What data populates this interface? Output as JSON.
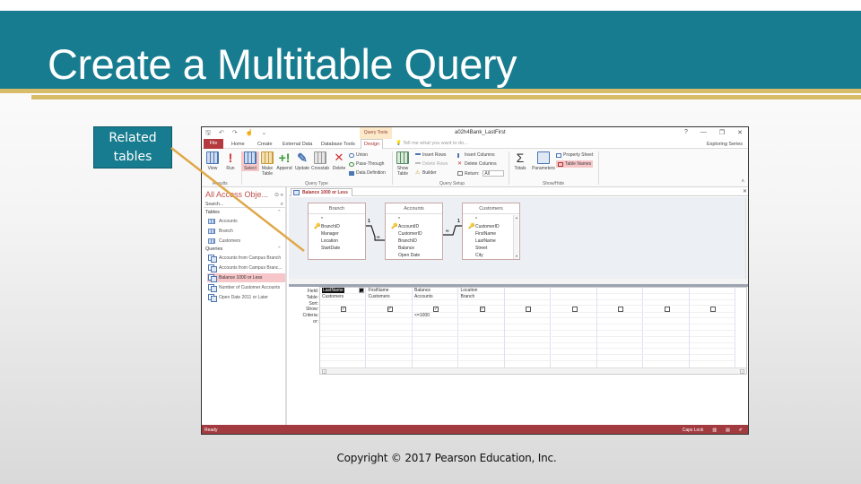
{
  "slide": {
    "title": "Create a Multitable Query",
    "callout": "Related tables",
    "copyright": "Copyright © 2017 Pearson Education, Inc.",
    "colors": {
      "header": "#177c8f",
      "accent_gold": "#d9bc6a",
      "access_red": "#a23b40"
    }
  },
  "access": {
    "context_label": "Query Tools",
    "doc_title": "a02h4Bank_LastFirst",
    "window_controls": [
      "?",
      "—",
      "❐",
      "✕"
    ],
    "user": "Exploring Series",
    "tabs": [
      "File",
      "Home",
      "Create",
      "External Data",
      "Database Tools",
      "Design"
    ],
    "tell_me": "Tell me what you want to do...",
    "ribbon": {
      "results": {
        "label": "Results",
        "buttons": [
          "View",
          "Run"
        ]
      },
      "query_type": {
        "label": "Query Type",
        "buttons": [
          "Select",
          "Make Table",
          "Append",
          "Update",
          "Crosstab",
          "Delete"
        ],
        "small": [
          "Union",
          "Pass-Through",
          "Data Definition"
        ]
      },
      "query_setup": {
        "label": "Query Setup",
        "show_table": "Show Table",
        "rows": [
          "Insert Rows",
          "Delete Rows",
          "Builder"
        ],
        "cols": [
          "Insert Columns",
          "Delete Columns",
          "Return:"
        ],
        "return_value": "All"
      },
      "show_hide": {
        "label": "Show/Hide",
        "buttons": [
          "Totals",
          "Parameters"
        ],
        "small": [
          "Property Sheet",
          "Table Names"
        ]
      }
    },
    "nav": {
      "title": "All Access Obje...",
      "search_placeholder": "Search...",
      "tables_header": "Tables",
      "tables": [
        "Accounts",
        "Branch",
        "Customers"
      ],
      "queries_header": "Queries",
      "queries": [
        "Accounts from Campus Branch",
        "Accounts from Campus Branc...",
        "Balance 1000 or Less",
        "Number of Customer Accounts",
        "Open Date 2011 or Later"
      ],
      "selected_query": "Balance 1000 or Less"
    },
    "document_tab": "Balance 1000 or Less",
    "field_lists": [
      {
        "name": "Branch",
        "fields": [
          "*",
          "BranchID",
          "Manager",
          "Location",
          "StartDate"
        ],
        "key": "BranchID"
      },
      {
        "name": "Accounts",
        "fields": [
          "*",
          "AccountID",
          "CustomerID",
          "BranchID",
          "Balance",
          "Open Date"
        ],
        "key": "AccountID"
      },
      {
        "name": "Customers",
        "fields": [
          "*",
          "CustomerID",
          "FirstName",
          "LastName",
          "Street",
          "City"
        ],
        "key": "CustomerID"
      }
    ],
    "relationships": [
      {
        "one": "1",
        "many": "∞"
      },
      {
        "one": "1",
        "many": "∞"
      }
    ],
    "grid": {
      "row_labels": [
        "Field:",
        "Table:",
        "Sort:",
        "Show:",
        "Criteria:",
        "or:"
      ],
      "columns": [
        {
          "field": "LastName",
          "table": "Customers",
          "show": true,
          "criteria": ""
        },
        {
          "field": "FirstName",
          "table": "Customers",
          "show": true,
          "criteria": ""
        },
        {
          "field": "Balance",
          "table": "Accounts",
          "show": true,
          "criteria": "<=1000"
        },
        {
          "field": "Location",
          "table": "Branch",
          "show": true,
          "criteria": ""
        },
        {
          "field": "",
          "table": "",
          "show": false,
          "criteria": ""
        },
        {
          "field": "",
          "table": "",
          "show": false,
          "criteria": ""
        },
        {
          "field": "",
          "table": "",
          "show": false,
          "criteria": ""
        },
        {
          "field": "",
          "table": "",
          "show": false,
          "criteria": ""
        },
        {
          "field": "",
          "table": "",
          "show": false,
          "criteria": ""
        }
      ]
    },
    "status": {
      "left": "Ready",
      "caps": "Caps Lock"
    }
  }
}
